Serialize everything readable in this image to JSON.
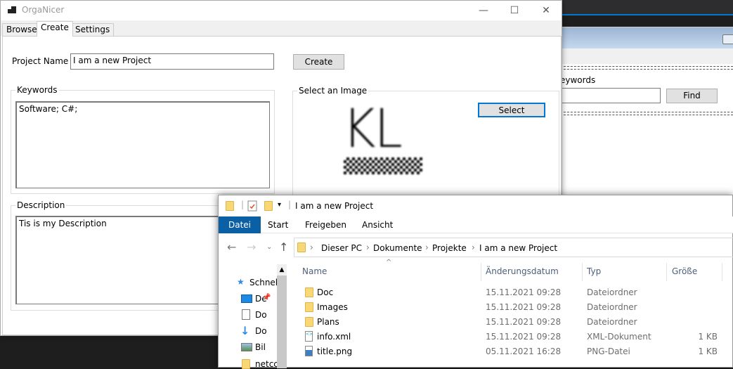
{
  "background_window": {
    "keywords_label": "eywords",
    "find_button": "Find"
  },
  "main_window": {
    "title": "OrgaNicer",
    "controls": {
      "minimize": "—",
      "maximize": "☐",
      "close": "✕"
    },
    "tabs": [
      {
        "label": "Browse"
      },
      {
        "label": "Create"
      },
      {
        "label": "Settings"
      }
    ],
    "project_name_label": "Project Name",
    "project_name_value": "I am a new Project",
    "create_button": "Create",
    "keywords_label": "Keywords",
    "keywords_value": "Software; C#;",
    "image_group_label": "Select an Image",
    "select_button": "Select",
    "image_text": "KL",
    "description_label": "Description",
    "description_value": "Tis is my Description"
  },
  "explorer": {
    "title": "I am a new Project",
    "ribbon_tabs": [
      "Datei",
      "Start",
      "Freigeben",
      "Ansicht"
    ],
    "breadcrumb": [
      "Dieser PC",
      "Dokumente",
      "Projekte",
      "I am a new Project"
    ],
    "nav_items": [
      "Schnel",
      "De",
      "Do",
      "Do",
      "Bil",
      "netcc"
    ],
    "columns": [
      "Name",
      "Änderungsdatum",
      "Typ",
      "Größe"
    ],
    "files": [
      {
        "name": "Doc",
        "date": "15.11.2021 09:28",
        "type": "Dateiordner",
        "size": "",
        "icon": "folder"
      },
      {
        "name": "Images",
        "date": "15.11.2021 09:28",
        "type": "Dateiordner",
        "size": "",
        "icon": "folder"
      },
      {
        "name": "Plans",
        "date": "15.11.2021 09:28",
        "type": "Dateiordner",
        "size": "",
        "icon": "folder"
      },
      {
        "name": "info.xml",
        "date": "15.11.2021 09:28",
        "type": "XML-Dokument",
        "size": "1 KB",
        "icon": "xml"
      },
      {
        "name": "title.png",
        "date": "05.11.2021 16:28",
        "type": "PNG-Datei",
        "size": "1 KB",
        "icon": "image"
      }
    ]
  }
}
